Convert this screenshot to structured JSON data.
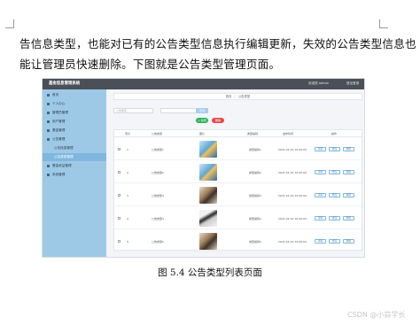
{
  "paragraph": {
    "line1": "告信息类型，也能对已有的公告类型信息执行编辑更新，失效的公告类型信息也",
    "line2": "能让管理员快速删除。下图就是公告类型管理页面。"
  },
  "screenshot": {
    "app_title": "基金信息管理系统",
    "welcome": "欢迎您 admin",
    "logout": "退出登录",
    "sidebar": [
      {
        "icon": "home-icon",
        "label": "首页",
        "sub": false,
        "active": false
      },
      {
        "icon": "user-icon",
        "label": "个人中心",
        "sub": false,
        "active": false
      },
      {
        "icon": "user-group-icon",
        "label": "管理员管理",
        "sub": false,
        "active": false
      },
      {
        "icon": "user-icon",
        "label": "用户管理",
        "sub": false,
        "active": false
      },
      {
        "icon": "fund-icon",
        "label": "基金管理",
        "sub": false,
        "active": false
      },
      {
        "icon": "notice-icon",
        "label": "公告管理",
        "sub": false,
        "active": false
      },
      {
        "icon": "",
        "label": "公告信息管理",
        "sub": true,
        "active": false
      },
      {
        "icon": "",
        "label": "公告类型管理",
        "sub": true,
        "active": true
      },
      {
        "icon": "chart-icon",
        "label": "基金收益管理",
        "sub": false,
        "active": false
      },
      {
        "icon": "gear-icon",
        "label": "系统管理",
        "sub": false,
        "active": false
      }
    ],
    "breadcrumb": [
      "首页",
      "公告类型"
    ],
    "search": {
      "placeholder": "公告类型",
      "button": "查询"
    },
    "add_button": "+ 新增",
    "delete_button": "删除",
    "columns": [
      "索引",
      "公告类型",
      "图片",
      "类型编码",
      "发布时间",
      "操作"
    ],
    "rows": [
      {
        "index": "1",
        "type": "公告类型1",
        "code": "类型编码1",
        "time": "2021-01-01 10:00:00",
        "image": "t1"
      },
      {
        "index": "2",
        "type": "公告类型2",
        "code": "类型编码2",
        "time": "2021-01-01 10:00:00",
        "image": "t1"
      },
      {
        "index": "3",
        "type": "公告类型3",
        "code": "类型编码3",
        "time": "2021-01-01 10:00:00",
        "image": "t2"
      },
      {
        "index": "4",
        "type": "公告类型4",
        "code": "类型编码4",
        "time": "2021-01-01 10:00:00",
        "image": "t3"
      },
      {
        "index": "5",
        "type": "公告类型5",
        "code": "类型编码5",
        "time": "2021-01-01 10:00:00",
        "image": "t2"
      }
    ],
    "actions": [
      "详情",
      "修改",
      "删除"
    ]
  },
  "caption": "图 5.4  公告类型列表页面",
  "watermark": "CSDN @小蒜学长"
}
